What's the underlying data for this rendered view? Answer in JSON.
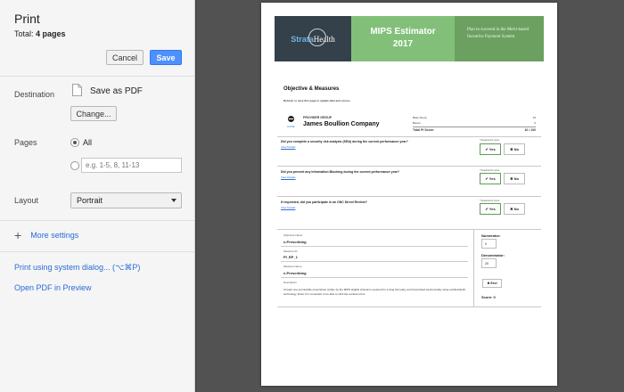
{
  "dialog": {
    "title": "Print",
    "total_label": "Total:",
    "total_value": "4 pages",
    "cancel_label": "Cancel",
    "save_label": "Save",
    "destination_label": "Destination",
    "destination_name": "Save as PDF",
    "change_label": "Change...",
    "pages_label": "Pages",
    "pages_all_label": "All",
    "pages_placeholder": "e.g. 1-5, 8, 11-13",
    "layout_label": "Layout",
    "layout_value": "Portrait",
    "more_settings_label": "More settings",
    "system_dialog_label": "Print using system dialog... (⌥⌘P)",
    "open_pdf_label": "Open PDF in Preview"
  },
  "preview": {
    "logo_part1": "Strata",
    "logo_part2": "Health",
    "banner_title_line1": "MIPS Estimator",
    "banner_title_line2": "2017",
    "banner_tagline": "Plan to succeed in the Merit-based Incentive Payment System",
    "objective_title": "Objective & Measures",
    "objective_note": "Refresh or save this page to update data and scores.",
    "close_label": "CLOSE",
    "provider_group_label": "PROVIDER GROUP",
    "provider_name": "James Boullion Company",
    "scores": [
      {
        "label": "Base Score:",
        "value": "10"
      },
      {
        "label": "Bonus:",
        "value": "0"
      },
      {
        "label": "Total PI Score:",
        "value": "10 / 100"
      }
    ],
    "questions": [
      {
        "text": "Did you complete a security risk analysis (SRA) during the current performance year?",
        "link": "View Details",
        "req": "* Required for score",
        "yes": "Yes",
        "no": "No"
      },
      {
        "text": "Did you prevent any Information Blocking during the current performance year?",
        "link": "View Details",
        "req": "* Required for score",
        "yes": "Yes",
        "no": "No"
      },
      {
        "text": "If requested, did you participate in an ONC Direct Review?",
        "link": "View Details",
        "req": "* Required for score",
        "yes": "Yes",
        "no": "No"
      }
    ],
    "measure": {
      "objective_name_label": "Objective Name",
      "objective_name": "e-Prescribing",
      "measure_id_label": "Measure ID",
      "measure_id": "PI_EP_1",
      "measure_name_label": "Measure Name",
      "measure_name": "e-Prescribing",
      "description_label": "Description",
      "description": "At least one permissible prescription written by the MIPS eligible clinician is queried for a drug formulary and transmitted electronically using certified EHR technology. Enter 0 in numerator to be able to click the exclusion box.",
      "numerator_label": "Numerator:",
      "numerator_value": "0",
      "denominator_label": "Denominator:",
      "denominator_value": "20",
      "exclude_label": "Excl",
      "score_label": "Score: 0"
    }
  }
}
